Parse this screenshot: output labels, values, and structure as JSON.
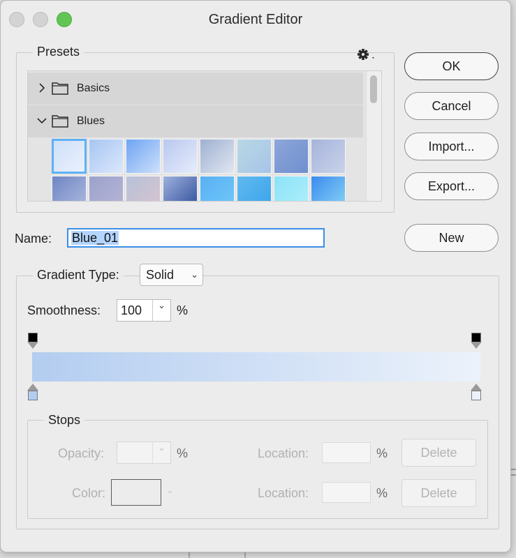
{
  "window": {
    "title": "Gradient Editor"
  },
  "presets": {
    "label": "Presets",
    "folders": [
      {
        "name": "Basics",
        "expanded": false
      },
      {
        "name": "Blues",
        "expanded": true
      }
    ],
    "swatches": [
      [
        "#cfe0f8",
        "#e9f0fc"
      ],
      [
        "#a7c6f3",
        "#dbe7fb"
      ],
      [
        "#6ea4f3",
        "#cde0fb"
      ],
      [
        "#b8c8ef",
        "#e6ecfb"
      ],
      [
        "#9eb0d2",
        "#e1e7f1"
      ],
      [
        "#b9d8e4",
        "#a7c4e8"
      ],
      [
        "#8ea6d9",
        "#6f8fcf"
      ],
      [
        "#a6b4da",
        "#c9d2ea"
      ],
      [
        "#6f86c4",
        "#aebbe0"
      ],
      [
        "#9aa3cc",
        "#b9b4d6"
      ],
      [
        "#b7c2d9",
        "#d8c3ce"
      ],
      [
        "#9eb1dd",
        "#2e4d9a"
      ],
      [
        "#5ab0f3",
        "#6fc8f9"
      ],
      [
        "#61b9f0",
        "#3aa3ea"
      ],
      [
        "#8ce2f7",
        "#aef0fb"
      ],
      [
        "#3b8bef",
        "#8ad5f5"
      ]
    ]
  },
  "buttons": {
    "ok": "OK",
    "cancel": "Cancel",
    "import": "Import...",
    "export": "Export...",
    "new": "New"
  },
  "name": {
    "label": "Name:",
    "value": "Blue_01"
  },
  "gradient": {
    "type_label": "Gradient Type:",
    "type_value": "Solid",
    "smoothness_label": "Smoothness:",
    "smoothness_value": "100",
    "percent": "%",
    "start_color": "#b3cdf0",
    "end_color": "#ecf2fb"
  },
  "stops": {
    "label": "Stops",
    "opacity_label": "Opacity:",
    "opacity_value": "",
    "color_label": "Color:",
    "location_label": "Location:",
    "location_value": "",
    "percent": "%",
    "delete_label": "Delete"
  }
}
